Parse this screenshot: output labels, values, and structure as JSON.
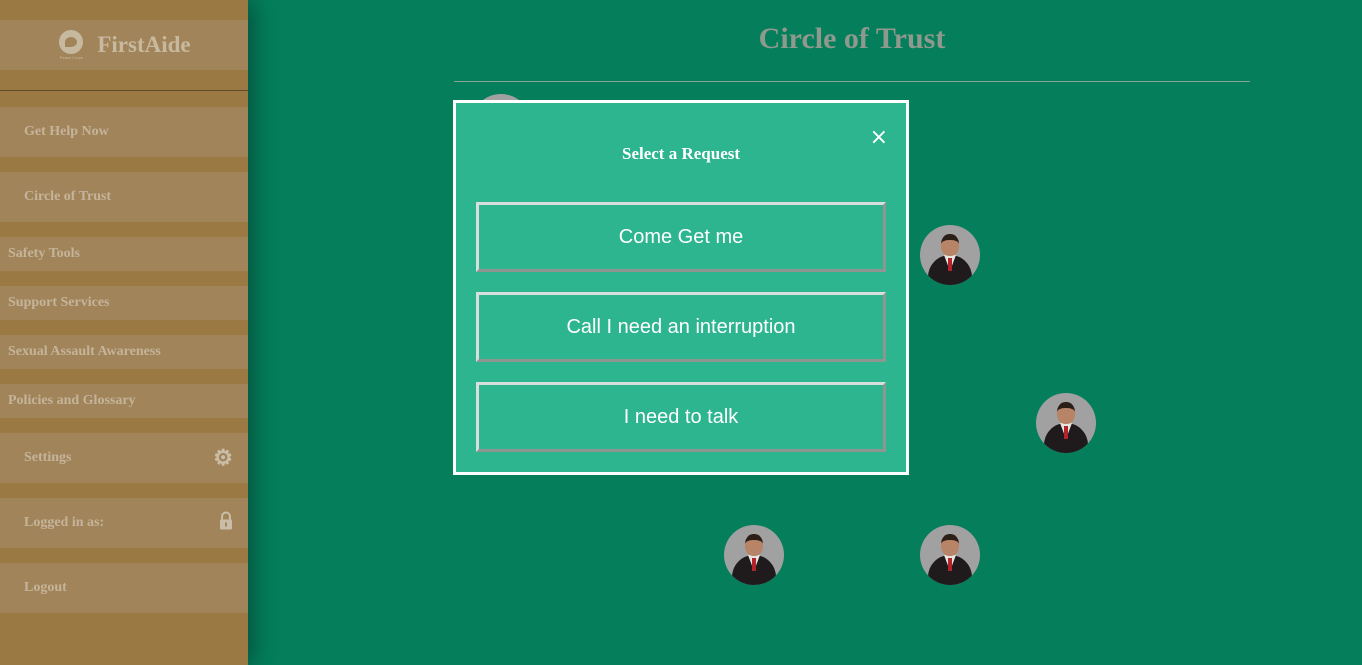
{
  "sidebar": {
    "brand": {
      "name": "FirstAide",
      "logo_caption": "Peace Corps"
    },
    "items": [
      {
        "label": "Get Help Now"
      },
      {
        "label": "Circle of Trust"
      },
      {
        "label": "Safety Tools"
      },
      {
        "label": "Support Services"
      },
      {
        "label": "Sexual Assault Awareness"
      },
      {
        "label": "Policies and Glossary"
      },
      {
        "label": "Settings",
        "icon": "gear-icon"
      },
      {
        "label": "Logged in as:",
        "icon": "lock-icon"
      },
      {
        "label": "Logout"
      }
    ]
  },
  "main": {
    "title": "Circle of Trust"
  },
  "modal": {
    "title": "Select a Request",
    "close_label": "×",
    "options": [
      {
        "label": "Come Get me"
      },
      {
        "label": "Call I need an interruption"
      },
      {
        "label": "I need to talk"
      }
    ]
  },
  "colors": {
    "sidebar": "#9a7943",
    "sidebar_item": "#a2845a",
    "main_background": "#047e5b",
    "modal_background": "#2db58f",
    "modal_border": "#ffffff"
  }
}
